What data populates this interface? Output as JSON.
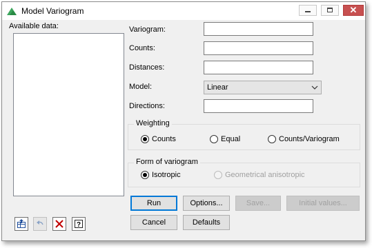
{
  "window": {
    "title": "Model Variogram"
  },
  "available_data": {
    "label": "Available data:"
  },
  "fields": {
    "variogram": {
      "label": "Variogram:",
      "value": ""
    },
    "counts": {
      "label": "Counts:",
      "value": ""
    },
    "distances": {
      "label": "Distances:",
      "value": ""
    },
    "model": {
      "label": "Model:",
      "value": "Linear"
    },
    "directions": {
      "label": "Directions:",
      "value": ""
    }
  },
  "weighting": {
    "title": "Weighting",
    "options": [
      "Counts",
      "Equal",
      "Counts/Variogram"
    ],
    "selected": "Counts"
  },
  "form_of_variogram": {
    "title": "Form of variogram",
    "options": [
      "Isotropic",
      "Geometrical anisotropic"
    ],
    "selected": "Isotropic"
  },
  "buttons": {
    "run": "Run",
    "options": "Options...",
    "save": "Save...",
    "initial_values": "Initial values...",
    "cancel": "Cancel",
    "defaults": "Defaults"
  },
  "icons": [
    "copy-to-spreadsheet-icon",
    "undo-icon",
    "clear-icon",
    "help-icon"
  ],
  "colors": {
    "accent": "#0078d7",
    "close_button": "#c75050",
    "app_icon": "#3ca55c"
  }
}
